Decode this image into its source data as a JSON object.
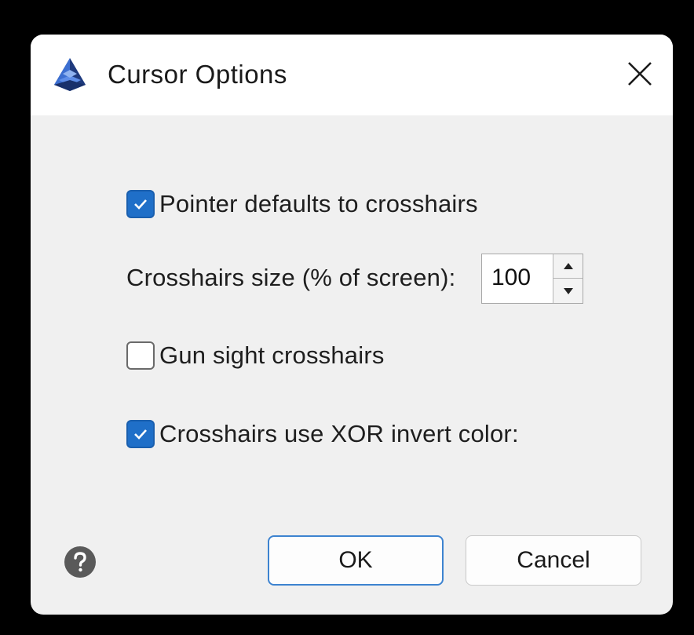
{
  "window": {
    "title": "Cursor Options",
    "app_icon": "pyramid-app-icon",
    "close_icon": "close-x-icon"
  },
  "options": {
    "pointer_crosshairs": {
      "label": "Pointer defaults to crosshairs",
      "checked": true
    },
    "crosshairs_size": {
      "label": "Crosshairs size (% of screen):",
      "value": "100"
    },
    "gun_sight": {
      "label": "Gun sight crosshairs",
      "checked": false
    },
    "xor_invert": {
      "label": "Crosshairs use XOR invert color:",
      "checked": true
    }
  },
  "footer": {
    "help_icon": "question-mark-icon",
    "ok_label": "OK",
    "cancel_label": "Cancel"
  },
  "colors": {
    "accent": "#1f6fc8",
    "background": "#f0f0f0",
    "titlebar": "#ffffff"
  }
}
